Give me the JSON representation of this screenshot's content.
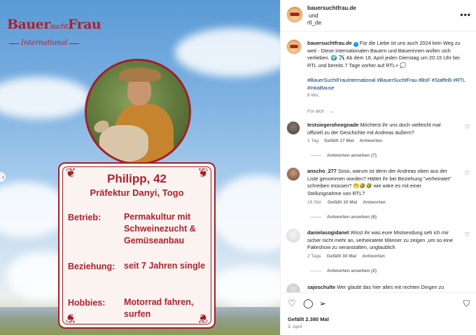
{
  "image": {
    "logo_line1": "Bauer",
    "logo_small": "sucht",
    "logo_line2": "Frau",
    "logo_sub": "International",
    "card": {
      "name": "Philipp, 42",
      "place": "Präfektur Danyi, Togo",
      "rows": [
        {
          "label": "Betrieb:",
          "value": "Permakultur mit Schweinezucht & Gemüseanbau"
        },
        {
          "label": "Beziehung:",
          "value": "seit 7 Jahren single"
        },
        {
          "label": "Hobbies:",
          "value": "Motorrad fahren, surfen"
        }
      ]
    },
    "brand_color": "#b21f2d"
  },
  "header": {
    "account1": "bauersuchtfrau.de",
    "and": "und",
    "account2": "rtl_de",
    "more_icon": "more-icon"
  },
  "caption": {
    "user": "bauersuchtfrau.de",
    "text": "Für die Liebe ist uns auch 2024 kein Weg zu weit - Diese internationalen Bauern und Bäuerinnen wollen sich verlieben. 🌍 ✈️ Ab dem 16. April jeden Dienstag um 20:15 Uhr bei RTL und bereits 7 Tage vorher auf RTL+ 💭",
    "hashtags": "#BauerSuchtFrauInternational #BauerSuchtFrau #BsF #Staffel6 #RTL #InkaBause",
    "time": "6 Wo."
  },
  "for_you": "Für dich",
  "comments": [
    {
      "user": "testsiegerohnegnade",
      "text": "Möchtest ihr uns doch vielleicht mal offiziell zu der Geschichte mit Andreas äußern?",
      "time": "1 Tag",
      "likes": "Gefällt 17 Mal",
      "reply": "Antworten",
      "view_replies": "Antworten ansehen (7)"
    },
    {
      "user": "anscho_277",
      "text": "Soso, warum ist denn der Andreas oben aus der Liste genommen worden? Hättet ihr bei Beziehung \"verheiratet\" schreiben müssen? 🤭🤣🤣 wie wäre es mit einer Stellungnahme von RTL?",
      "time": "19 Std.",
      "likes": "Gefällt 10 Mal",
      "reply": "Antworten",
      "view_replies": "Antworten ansehen (6)"
    },
    {
      "user": "danielasogidanet",
      "text": "Wisst ihr was.eure Mistsendung seh ich mir sicher nicht mehr an, verheiratete Männer zu zeigen ,um so eine Fakeshow zu veranstalten, unglaublich",
      "time": "2 Tage",
      "likes": "Gefällt 30 Mal",
      "reply": "Antworten",
      "view_replies": "Antworten ansehen (2)"
    },
    {
      "user": "sajoschulte",
      "text": "Wer glaubt das hier alles mit rechten Dingen zu"
    }
  ],
  "footer": {
    "likes": "Gefällt 2.380 Mal",
    "date": "3. April"
  }
}
